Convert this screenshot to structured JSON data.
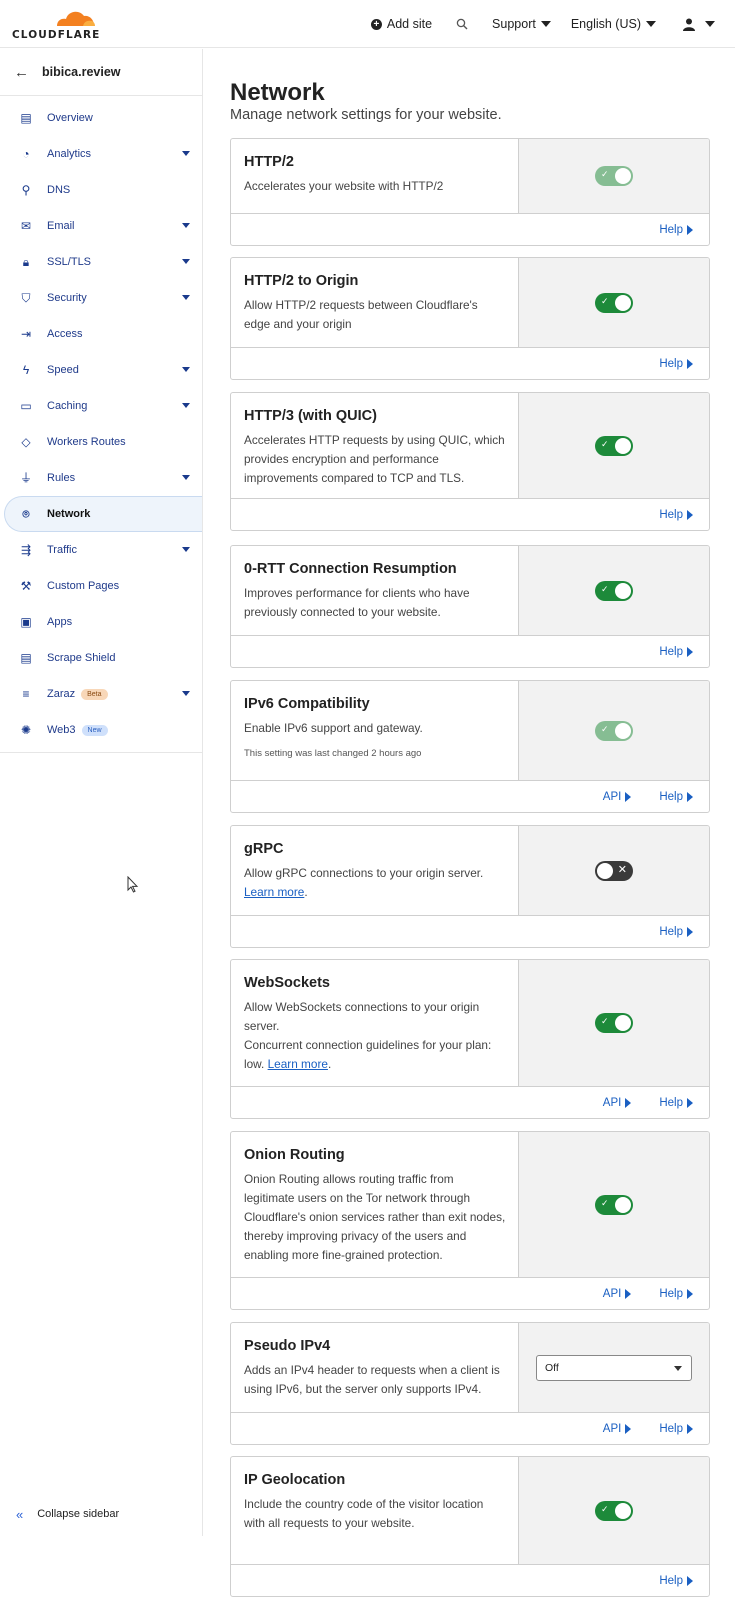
{
  "brand": {
    "logo_text": "CLOUDFLARE",
    "accent": "#f38020"
  },
  "topbar": {
    "add_site": "Add site",
    "support": "Support",
    "language": "English (US)"
  },
  "sidebar": {
    "site_name": "bibica.review",
    "items": [
      {
        "label": "Overview",
        "icon": "document-icon",
        "caret": false
      },
      {
        "label": "Analytics",
        "icon": "pie-chart-icon",
        "caret": true
      },
      {
        "label": "DNS",
        "icon": "network-tree-icon",
        "caret": false
      },
      {
        "label": "Email",
        "icon": "mail-icon",
        "caret": true
      },
      {
        "label": "SSL/TLS",
        "icon": "lock-icon",
        "caret": true
      },
      {
        "label": "Security",
        "icon": "shield-icon",
        "caret": true
      },
      {
        "label": "Access",
        "icon": "access-arrow-icon",
        "caret": false
      },
      {
        "label": "Speed",
        "icon": "lightning-icon",
        "caret": true
      },
      {
        "label": "Caching",
        "icon": "server-icon",
        "caret": true
      },
      {
        "label": "Workers Routes",
        "icon": "code-brackets-icon",
        "caret": false
      },
      {
        "label": "Rules",
        "icon": "funnel-icon",
        "caret": true
      },
      {
        "label": "Network",
        "icon": "location-pin-icon",
        "caret": false,
        "active": true
      },
      {
        "label": "Traffic",
        "icon": "traffic-flow-icon",
        "caret": true
      },
      {
        "label": "Custom Pages",
        "icon": "wrench-icon",
        "caret": false
      },
      {
        "label": "Apps",
        "icon": "apps-icon",
        "caret": false
      },
      {
        "label": "Scrape Shield",
        "icon": "document-shield-icon",
        "caret": false
      },
      {
        "label": "Zaraz",
        "icon": "zaraz-icon",
        "caret": true,
        "badge": "Beta"
      },
      {
        "label": "Web3",
        "icon": "web3-icon",
        "caret": false,
        "badge": "New"
      }
    ],
    "collapse_label": "Collapse sidebar"
  },
  "main": {
    "title": "Network",
    "subtitle": "Manage network settings for your website.",
    "help_label": "Help",
    "api_label": "API",
    "cards": [
      {
        "title": "HTTP/2",
        "desc": "Accelerates your website with HTTP/2",
        "control": "toggle",
        "state": "on-locked",
        "api": false
      },
      {
        "title": "HTTP/2 to Origin",
        "desc": "Allow HTTP/2 requests between Cloudflare's edge and your origin",
        "control": "toggle",
        "state": "on",
        "api": false
      },
      {
        "title": "HTTP/3 (with QUIC)",
        "desc": "Accelerates HTTP requests by using QUIC, which provides encryption and performance improvements compared to TCP and TLS.",
        "control": "toggle",
        "state": "on",
        "api": false
      },
      {
        "title": "0-RTT Connection Resumption",
        "desc": "Improves performance for clients who have previously connected to your website.",
        "control": "toggle",
        "state": "on",
        "api": false
      },
      {
        "title": "IPv6 Compatibility",
        "desc": "Enable IPv6 support and gateway.",
        "note": "This setting was last changed 2 hours ago",
        "control": "toggle",
        "state": "on-locked",
        "api": true
      },
      {
        "title": "gRPC",
        "desc": "Allow gRPC connections to your origin server.",
        "link": "Learn more",
        "control": "toggle",
        "state": "off",
        "api": false
      },
      {
        "title": "WebSockets",
        "desc": "Allow WebSockets connections to your origin server.",
        "desc2": "Concurrent connection guidelines for your plan: low.",
        "link": "Learn more",
        "control": "toggle",
        "state": "on",
        "api": true
      },
      {
        "title": "Onion Routing",
        "desc": "Onion Routing allows routing traffic from legitimate users on the Tor network through Cloudflare's onion services rather than exit nodes, thereby improving privacy of the users and enabling more fine-grained protection.",
        "control": "toggle",
        "state": "on",
        "api": true
      },
      {
        "title": "Pseudo IPv4",
        "desc": "Adds an IPv4 header to requests when a client is using IPv6, but the server only supports IPv4.",
        "control": "select",
        "value": "Off",
        "api": true
      },
      {
        "title": "IP Geolocation",
        "desc": "Include the country code of the visitor location with all requests to your website.",
        "control": "toggle",
        "state": "on",
        "api": false
      }
    ]
  }
}
